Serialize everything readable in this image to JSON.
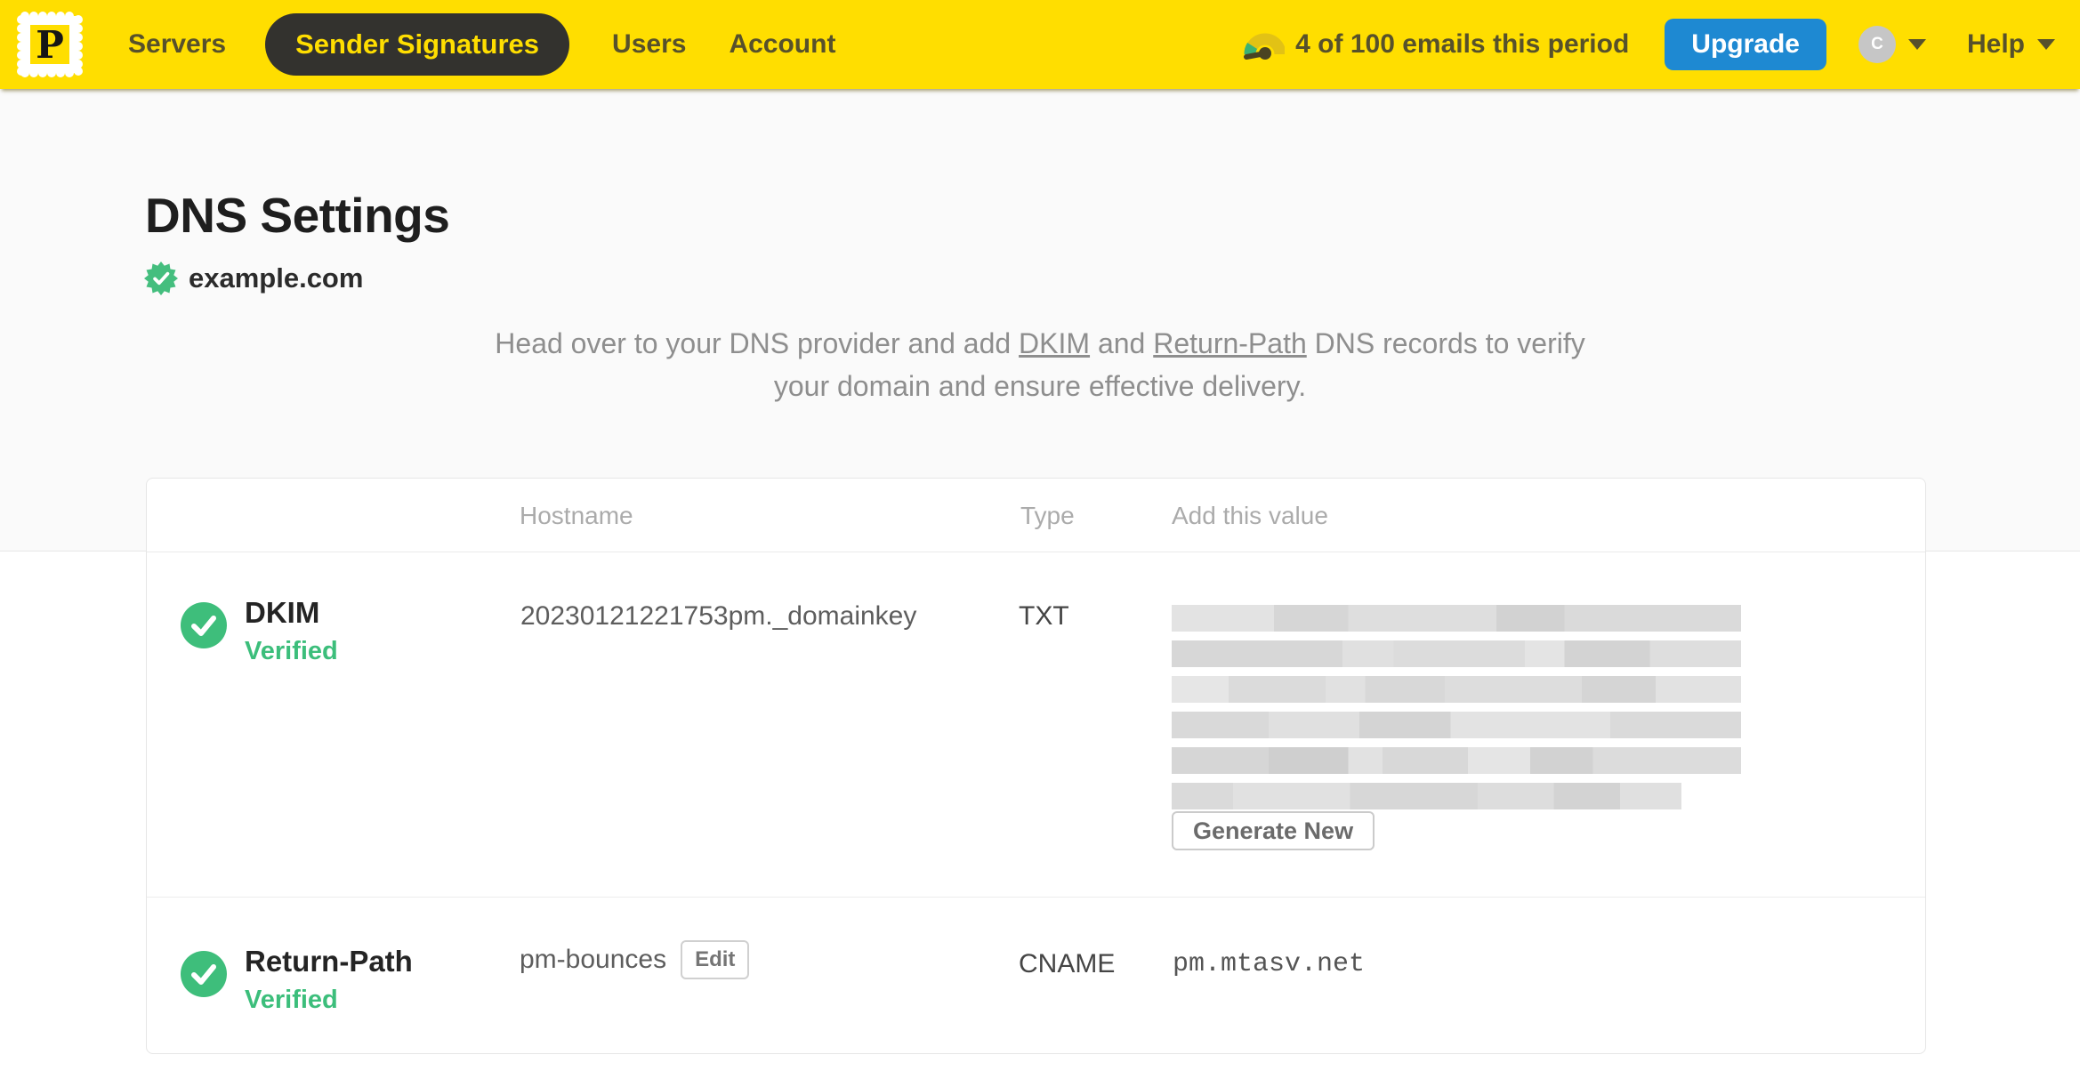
{
  "colors": {
    "brand_yellow": "#FFDE00",
    "nav_text": "#57512B",
    "active_pill_bg": "#33322E",
    "upgrade_blue": "#1E89D2",
    "verified_green": "#3CBE7B",
    "page_bg_top": "#FAFAFA",
    "card_bg": "#FFFFFF"
  },
  "icons": {
    "logo": "postmark-stamp-icon",
    "usage": "gauge-icon",
    "domain_badge": "verified-seal-icon",
    "row_status": "check-circle-icon",
    "dropdown": "caret-down-icon"
  },
  "navbar": {
    "logo_letter": "P",
    "items": [
      {
        "label": "Servers",
        "active": false
      },
      {
        "label": "Sender Signatures",
        "active": true
      },
      {
        "label": "Users",
        "active": false
      },
      {
        "label": "Account",
        "active": false
      }
    ],
    "usage_text": "4 of 100 emails this period",
    "upgrade_label": "Upgrade",
    "avatar_initial": "C",
    "help_label": "Help"
  },
  "page": {
    "title": "DNS Settings",
    "domain": "example.com",
    "intro": {
      "part1": "Head over to your DNS provider and add ",
      "link_dkim": "DKIM",
      "part2": " and ",
      "link_return_path": "Return-Path",
      "part3": " DNS records to verify your domain and ensure effective delivery."
    }
  },
  "table": {
    "headers": {
      "hostname": "Hostname",
      "type": "Type",
      "value": "Add this value"
    },
    "rows": [
      {
        "name": "DKIM",
        "status": "Verified",
        "hostname": "20230121221753pm._domainkey",
        "type": "TXT",
        "value": "redacted",
        "action_label": "Generate New"
      },
      {
        "name": "Return-Path",
        "status": "Verified",
        "hostname": "pm-bounces",
        "edit_label": "Edit",
        "type": "CNAME",
        "value": "pm.mtasv.net"
      }
    ]
  }
}
